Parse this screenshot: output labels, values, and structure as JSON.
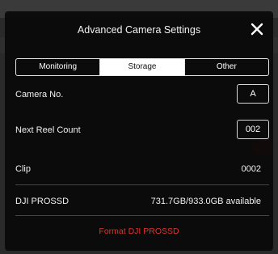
{
  "dialog": {
    "title": "Advanced Camera Settings"
  },
  "tabs": [
    {
      "label": "Monitoring",
      "active": false
    },
    {
      "label": "Storage",
      "active": true
    },
    {
      "label": "Other",
      "active": false
    }
  ],
  "rows": {
    "camera_no": {
      "label": "Camera No.",
      "value": "A"
    },
    "next_reel": {
      "label": "Next Reel Count",
      "value": "002"
    },
    "clip": {
      "label": "Clip",
      "value": "0002"
    },
    "storage": {
      "label": "DJI PROSSD",
      "value": "731.7GB/933.0GB available"
    }
  },
  "actions": {
    "format_label": "Format DJI PROSSD"
  },
  "colors": {
    "accent_danger": "#e0322c",
    "panel_bg": "#0a0a0a",
    "tab_active_bg": "#ffffff"
  },
  "icons": {
    "close": "close-icon"
  }
}
